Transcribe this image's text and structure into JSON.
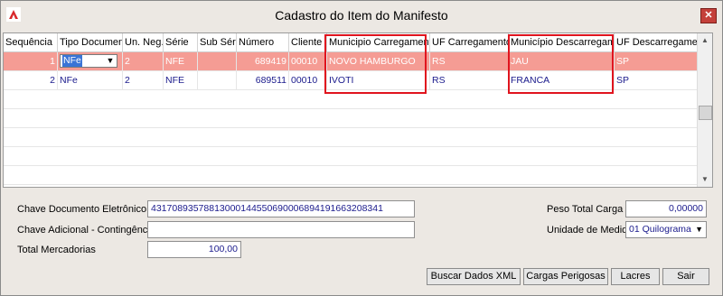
{
  "window": {
    "title": "Cadastro do Item do Manifesto",
    "close_symbol": "✕",
    "accent": "#c4403a"
  },
  "grid": {
    "columns": [
      "Sequência",
      "Tipo Documento",
      "Un. Neg.",
      "Série",
      "Sub Série",
      "Número",
      "Cliente",
      "Municipio Carregamento",
      "UF Carregamento",
      "Município Descarregamento",
      "UF Descarregamento"
    ],
    "rows": [
      {
        "seq": "1",
        "tipo": "NFe",
        "un_neg": "2",
        "serie": "NFE",
        "sub_serie": "",
        "numero": "689419",
        "cliente": "00010",
        "mun_carreg": "NOVO HAMBURGO",
        "uf_carreg": "RS",
        "mun_descarreg": "JAU",
        "uf_descarreg": "SP"
      },
      {
        "seq": "2",
        "tipo": "NFe",
        "un_neg": "2",
        "serie": "NFE",
        "sub_serie": "",
        "numero": "689511",
        "cliente": "00010",
        "mun_carreg": "IVOTI",
        "uf_carreg": "RS",
        "mun_descarreg": "FRANCA",
        "uf_descarreg": "SP"
      }
    ],
    "selected_row_color": "#f59c94",
    "highlight_color": "#e0141e"
  },
  "form": {
    "chave_label": "Chave Documento Eletrônico",
    "chave_value": "43170893578813000144550690006894191663208341",
    "chave_adic_label": "Chave Adicional - Contingência FS",
    "chave_adic_value": "",
    "total_label": "Total Mercadorias",
    "total_value": "100,00",
    "peso_label": "Peso Total Carga",
    "peso_value": "0,00000",
    "unidade_label": "Unidade de Medida",
    "unidade_value": "01 Quilograma"
  },
  "buttons": {
    "buscar_xml": "Buscar Dados XML",
    "cargas_perigosas": "Cargas Perigosas",
    "lacres": "Lacres",
    "sair": "Sair"
  }
}
